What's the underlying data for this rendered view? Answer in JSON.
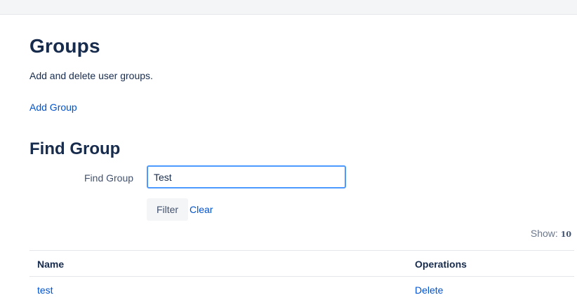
{
  "page": {
    "title": "Groups",
    "description": "Add and delete user groups.",
    "add_group_link": "Add Group"
  },
  "find": {
    "heading": "Find Group",
    "label": "Find Group",
    "value": "Test",
    "filter_label": "Filter",
    "clear_label": "Clear"
  },
  "pagination": {
    "show_label": "Show:",
    "show_value": "10"
  },
  "table": {
    "columns": [
      "Name",
      "Operations"
    ],
    "rows": [
      {
        "name": "test",
        "operation": "Delete"
      }
    ]
  }
}
